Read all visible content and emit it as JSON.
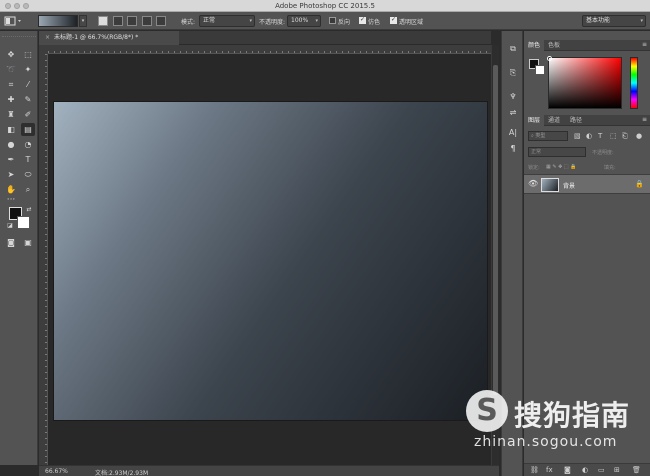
{
  "app": {
    "title": "Adobe Photoshop CC 2015.5"
  },
  "options": {
    "mode_label": "模式:",
    "mode_value": "正常",
    "opacity_label": "不透明度:",
    "opacity_value": "100%",
    "reverse_label": "反向",
    "dither_label": "仿色",
    "transparency_label": "透明区域",
    "workspace_value": "基本功能"
  },
  "document": {
    "tab_title": "未标题-1 @ 66.7%(RGB/8*) *",
    "tab_close": "×"
  },
  "status": {
    "zoom": "66.67%",
    "doc_size": "文档:2.93M/2.93M"
  },
  "panels": {
    "color_tabs": [
      "颜色",
      "色板"
    ],
    "layer_tabs": [
      "图层",
      "通道",
      "路径"
    ],
    "filter_kind": "类型",
    "blend_mode": "正常",
    "opacity_label": "不透明度:",
    "lock_label": "锁定:",
    "fill_label": "填充:",
    "layer_name": "背景"
  },
  "watermark": {
    "brand": "搜狗指南",
    "url": "zhinan.sogou.com"
  },
  "colors": {
    "accent": "#535353",
    "canvas_start": "#a3b2c0",
    "canvas_end": "#1b1f24"
  }
}
